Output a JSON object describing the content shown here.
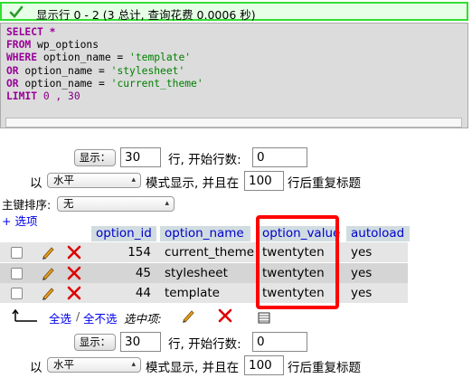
{
  "banner": {
    "text": "显示行 0 - 2 (3 总计, 查询花费 0.0006 秒)"
  },
  "sql": {
    "lines": [
      [
        {
          "t": "SELECT *",
          "c": "kw"
        }
      ],
      [
        {
          "t": "FROM",
          "c": "kw"
        },
        {
          "t": " wp_options",
          "c": ""
        }
      ],
      [
        {
          "t": "WHERE",
          "c": "kw"
        },
        {
          "t": " option_name = ",
          "c": ""
        },
        {
          "t": "'template'",
          "c": "str"
        }
      ],
      [
        {
          "t": "OR",
          "c": "kw"
        },
        {
          "t": " option_name = ",
          "c": ""
        },
        {
          "t": "'stylesheet'",
          "c": "str"
        }
      ],
      [
        {
          "t": "OR",
          "c": "kw"
        },
        {
          "t": " option_name = ",
          "c": ""
        },
        {
          "t": "'current_theme'",
          "c": "str"
        }
      ],
      [
        {
          "t": "LIMIT",
          "c": "kw"
        },
        {
          "t": " 0 , 30",
          "c": "num"
        }
      ]
    ]
  },
  "nav_top": {
    "show_button": "显示：",
    "rows_value": "30",
    "rows_label": "行, 开始行数:",
    "start_value": "0",
    "mode_prefix": "以",
    "mode_select": "水平",
    "mode_label": "模式显示, 并且在",
    "repeat_value": "100",
    "repeat_label": "行后重复标题"
  },
  "sort": {
    "label": "主键排序:",
    "value": "无"
  },
  "options_link": "+ 选项",
  "table": {
    "columns": [
      "option_id",
      "option_name",
      "option_value",
      "autoload"
    ],
    "rows": [
      {
        "id": "154",
        "name": "current_theme",
        "value": "twentyten",
        "autoload": "yes"
      },
      {
        "id": "45",
        "name": "stylesheet",
        "value": "twentyten",
        "autoload": "yes"
      },
      {
        "id": "44",
        "name": "template",
        "value": "twentyten",
        "autoload": "yes"
      }
    ]
  },
  "bulk": {
    "select_all": "全选",
    "separator": "/",
    "deselect_all": "全不选",
    "with_selected": "选中项:"
  },
  "nav_bottom": {
    "show_button": "显示：",
    "rows_value": "30",
    "rows_label": "行, 开始行数:",
    "start_value": "0",
    "mode_prefix": "以",
    "mode_select": "水平",
    "mode_label": "模式显示, 并且在",
    "repeat_value": "100",
    "repeat_label": "行后重复标题"
  },
  "colors": {
    "banner_border": "#33dd33",
    "highlight": "#ff0000",
    "link": "#0000ee",
    "keyword": "#990099",
    "string": "#008000"
  }
}
